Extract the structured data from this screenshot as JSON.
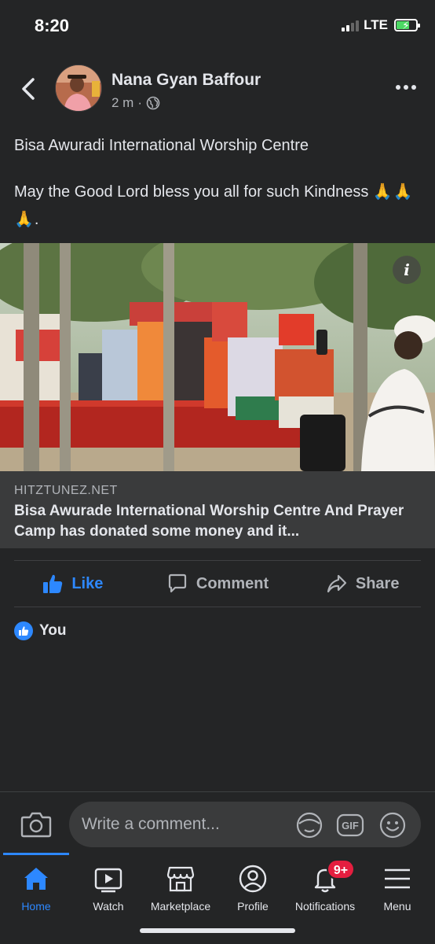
{
  "status_bar": {
    "time": "8:20",
    "network": "LTE"
  },
  "post": {
    "author": "Nana Gyan Baffour",
    "time_ago": "2 m",
    "separator": "·",
    "text_line1": "Bisa Awuradi International Worship Centre",
    "text_line2": "May the Good Lord bless you all for such Kindness",
    "emoji": "🙏🙏🙏",
    "text_end": ".",
    "image_alt": "Donated goods stacked on a red table under trees",
    "link": {
      "domain": "HITZTUNEZ.NET",
      "title": "Bisa Awurade International Worship Centre And Prayer Camp has donated some money and it..."
    }
  },
  "actions": {
    "like": "Like",
    "comment": "Comment",
    "share": "Share"
  },
  "reactions": {
    "label": "You"
  },
  "comment_bar": {
    "placeholder": "Write a comment..."
  },
  "nav": [
    {
      "label": "Home"
    },
    {
      "label": "Watch"
    },
    {
      "label": "Marketplace"
    },
    {
      "label": "Profile"
    },
    {
      "label": "Notifications",
      "badge": "9+"
    },
    {
      "label": "Menu"
    }
  ],
  "colors": {
    "accent": "#2d88ff",
    "background": "#242526",
    "badge": "#e41e3f"
  }
}
